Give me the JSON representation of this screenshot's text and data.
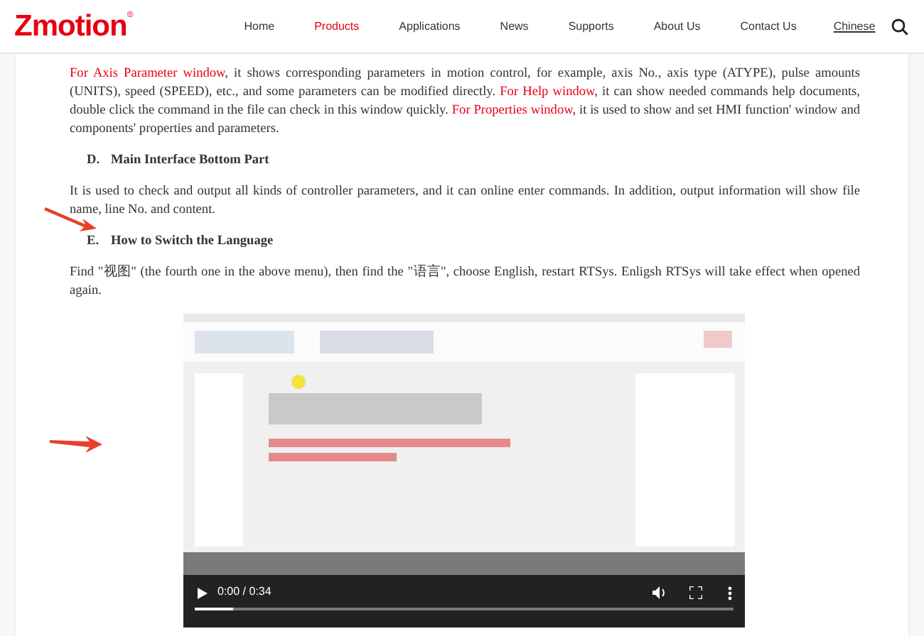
{
  "header": {
    "logo": "Zmotion",
    "logo_mark": "®",
    "nav": [
      {
        "label": "Home",
        "selected": false
      },
      {
        "label": "Products",
        "selected": true
      },
      {
        "label": "Applications",
        "selected": false
      },
      {
        "label": "News",
        "selected": false
      },
      {
        "label": "Supports",
        "selected": false
      },
      {
        "label": "About Us",
        "selected": false
      },
      {
        "label": "Contact Us",
        "selected": false
      }
    ],
    "language": "Chinese"
  },
  "article": [
    {
      "kind": "paragraph",
      "parts": [
        {
          "text": "For Axis Parameter window",
          "highlight": true
        },
        {
          "text": ", it shows corresponding parameters in motion control, for example, axis No., axis type (ATYPE), pulse amounts (UNITS), speed (SPEED), etc., and some parameters can be modified directly. ",
          "highlight": false
        },
        {
          "text": "For Help window",
          "highlight": true
        },
        {
          "text": ", it can show needed commands help documents, double click the command in the file can check in this window quickly. ",
          "highlight": false
        },
        {
          "text": "For Properties window",
          "highlight": true
        },
        {
          "text": ", it is used to show and set HMI function' window and components' properties and parameters.",
          "highlight": false
        }
      ]
    },
    {
      "kind": "heading",
      "marker": "D.",
      "text": "Main Interface Bottom Part",
      "arrow": false
    },
    {
      "kind": "paragraph",
      "parts": [
        {
          "text": "It is used to check and output all kinds of controller parameters, and it can online enter commands. In addition, output information will show file name, line No. and content.",
          "highlight": false
        }
      ]
    },
    {
      "kind": "heading",
      "marker": "E.",
      "text": "How to Switch the Language",
      "arrow": true
    },
    {
      "kind": "paragraph",
      "parts": [
        {
          "text": "Find \"视图\" (the fourth one in the above menu), then find the \"语言\", choose English, restart RTSys. Enligsh RTSys will take effect when opened again.",
          "highlight": false
        }
      ]
    },
    {
      "kind": "video",
      "arrow": true,
      "time": "0:00 / 0:34",
      "level": 0.07
    }
  ]
}
